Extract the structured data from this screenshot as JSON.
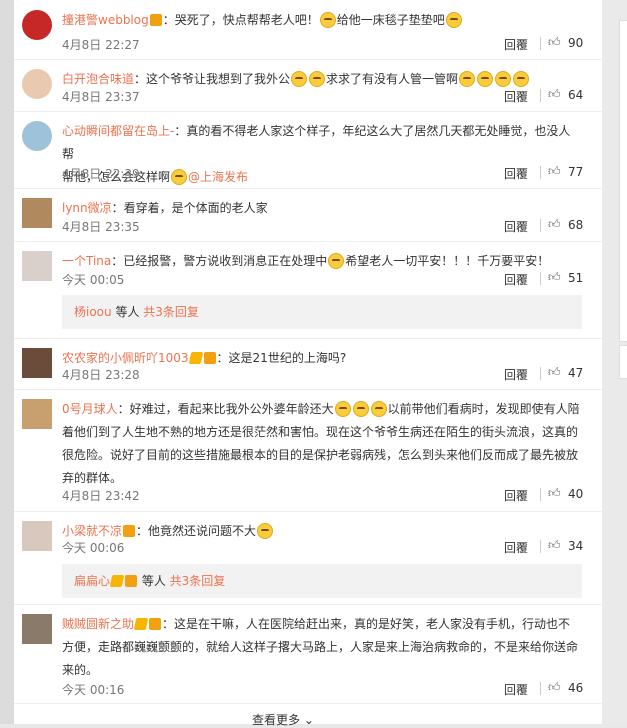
{
  "comments": [
    {
      "user": "撞港警webblog",
      "text_a": "：哭死了，快点帮帮老人吧！",
      "text_b": "给他一床毯子垫垫吧",
      "time": "4月8日 22:27",
      "reply": "回覆",
      "likes": "90"
    },
    {
      "user": "白开泡合味道",
      "text_a": "：这个爷爷让我想到了我外公",
      "text_b": "求求了有没有人管一管啊",
      "time": "4月8日 23:37",
      "reply": "回覆",
      "likes": "64"
    },
    {
      "user": "心动瞬间都留在岛上-",
      "text_a": "：真的看不得老人家这个样子，年纪这么大了居然几天都无处睡觉，也没人帮",
      "text_b": "帮他，怎么会这样啊",
      "mention": "@上海发布",
      "time": "4月8日 22:39",
      "reply": "回覆",
      "likes": "77"
    },
    {
      "user": "lynn微凉",
      "text_a": "：看穿着，是个体面的老人家",
      "time": "4月8日 23:35",
      "reply": "回覆",
      "likes": "68"
    },
    {
      "user": "一个Tina",
      "text_a": "：已经报警，警方说收到消息正在处理中",
      "text_b": "希望老人一切平安！！！千万要平安！",
      "time": "今天 00:05",
      "reply": "回覆",
      "likes": "51",
      "sub_user": "杨ioou",
      "sub_text": " 等人 ",
      "sub_link": "共3条回复"
    },
    {
      "user": "农农家的小佩昕吖1003",
      "text_a": "：这是21世纪的上海吗?",
      "time": "4月8日 23:28",
      "reply": "回覆",
      "likes": "47"
    },
    {
      "user": "0号月球人",
      "text_a": "：好难过，看起来比我外公外婆年龄还大",
      "text_b": "以前带他们看病时，发现即使有人陪",
      "text_c": "着他们到了人生地不熟的地方还是很茫然和害怕。现在这个爷爷生病还在陌生的街头流浪，这真的",
      "text_d": "很危险。说好了目前的这些措施最根本的目的是保护老弱病残，怎么到头来他们反而成了最先被放",
      "text_e": "弃的群体。",
      "time": "4月8日 23:42",
      "reply": "回覆",
      "likes": "40"
    },
    {
      "user": "小梁就不凉",
      "text_a": "：他竟然还说问题不大",
      "time": "今天 00:06",
      "reply": "回覆",
      "likes": "34",
      "sub_user": "扁扁心",
      "sub_text": " 等人 ",
      "sub_link": "共3条回复"
    },
    {
      "user": "贼贼圆新之助",
      "text_a": "：这是在干嘛，人在医院给赶出来，真的是好笑，老人家没有手机，行动也不",
      "text_b": "方便，走路都巍巍颤颤的，就给人这样子撂大马路上，人家是来上海治病救命的，不是来给你送命",
      "text_c": "来的。",
      "time": "今天 00:16",
      "reply": "回覆",
      "likes": "46"
    }
  ],
  "more_label": "查看更多 ⌄",
  "colors": {
    "accent": "#eb7350",
    "vip": "#f0a010"
  },
  "icons": {
    "like": "thumb-up-icon",
    "emoji": "crying-emoji-icon"
  }
}
